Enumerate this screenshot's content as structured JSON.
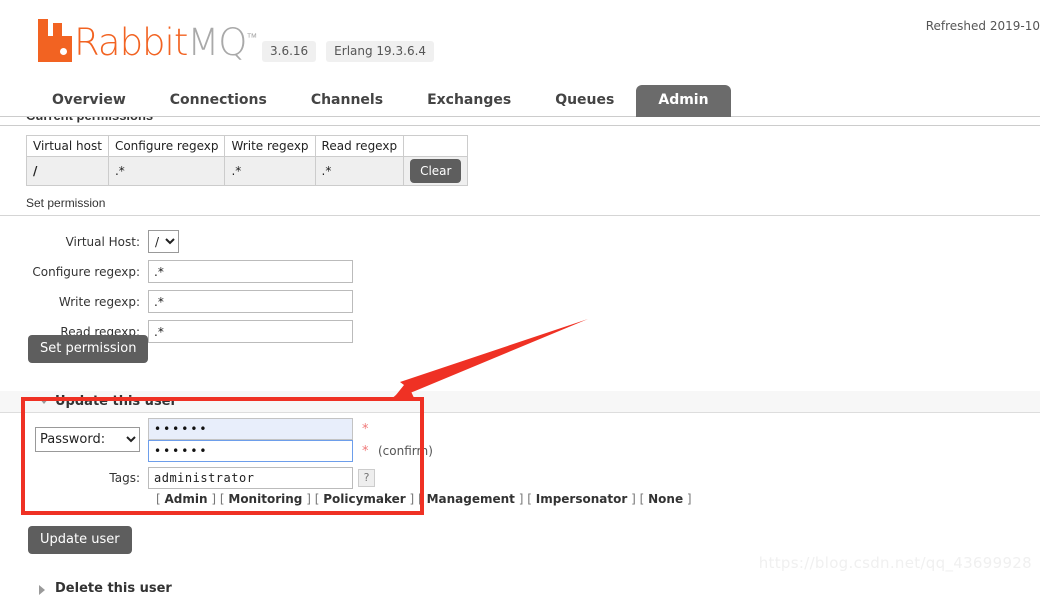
{
  "header": {
    "logo_text_primary": "Rabbit",
    "logo_text_secondary": "MQ",
    "logo_tm": "™",
    "version_badge": "3.6.16",
    "erlang_badge": "Erlang 19.3.6.4",
    "refreshed": "Refreshed 2019-10"
  },
  "nav": {
    "tabs": [
      {
        "label": "Overview",
        "active": false
      },
      {
        "label": "Connections",
        "active": false
      },
      {
        "label": "Channels",
        "active": false
      },
      {
        "label": "Exchanges",
        "active": false
      },
      {
        "label": "Queues",
        "active": false
      },
      {
        "label": "Admin",
        "active": true
      }
    ]
  },
  "current_permissions": {
    "title": "Current permissions",
    "columns": [
      "Virtual host",
      "Configure regexp",
      "Write regexp",
      "Read regexp",
      ""
    ],
    "rows": [
      {
        "virtual_host": "/",
        "configure_regexp": ".*",
        "write_regexp": ".*",
        "read_regexp": ".*",
        "action_label": "Clear"
      }
    ]
  },
  "set_permission": {
    "title": "Set permission",
    "virtual_host_label": "Virtual Host:",
    "virtual_host_value": "/",
    "configure_label": "Configure regexp:",
    "configure_value": ".*",
    "write_label": "Write regexp:",
    "write_value": ".*",
    "read_label": "Read regexp:",
    "read_value": ".*",
    "submit_label": "Set permission"
  },
  "update_user": {
    "section_title": "Update this user",
    "credential_type": "Password:",
    "password_value": "••••••",
    "password_confirm_value": "••••••",
    "required_marker": "*",
    "confirm_label": "(confirm)",
    "tags_label": "Tags:",
    "tags_value": "administrator",
    "help_label": "?",
    "tag_links": [
      "Admin",
      "Monitoring",
      "Policymaker",
      "Management",
      "Impersonator",
      "None"
    ],
    "submit_label": "Update user"
  },
  "delete_user": {
    "section_title": "Delete this user"
  },
  "annotation": {
    "color": "#ef3124"
  },
  "watermark": {
    "text": "https://blog.csdn.net/qq_43699928"
  }
}
